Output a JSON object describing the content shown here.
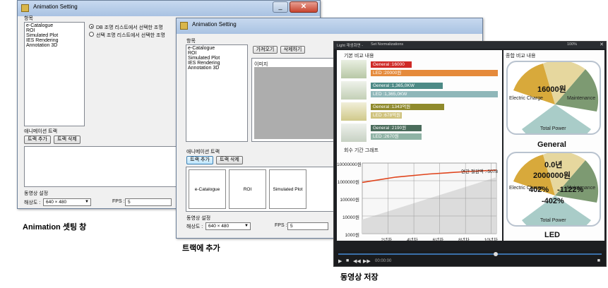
{
  "window1": {
    "title": "Animation Setting",
    "items_label": "항목",
    "items": [
      "e-Catalogue",
      "ROI",
      "Simulated Plot",
      "IES Rendering",
      "Annotation 3D"
    ],
    "radio1": "DB 조명 리스트에서 선택한 조명",
    "radio2": "선택 조명 리스트에서 선택한 조명",
    "track_label": "애니메이션 트랙",
    "add_track": "트랙 추가",
    "del_track": "트랙 삭제",
    "video_label": "동영상 설정",
    "resolution_label": "해상도 :",
    "resolution_value": "640 × 480",
    "fps_label": "FPS :",
    "fps_value": "5"
  },
  "window2": {
    "title": "Animation Setting",
    "items_label": "항목",
    "items": [
      "e-Catalogue",
      "ROI",
      "Simulated Plot",
      "IES Rendering",
      "Annotation 3D"
    ],
    "load_btn": "가져오기",
    "delete_btn": "삭제하기",
    "image_label": "이미지",
    "track_label": "애니메이션 트랙",
    "add_track": "트랙 추가",
    "del_track": "트랙 삭제",
    "track_items": [
      "e-Catalogue",
      "ROI",
      "Simulated Plot"
    ],
    "video_label": "동영상 설정",
    "resolution_label": "해상도 :",
    "resolution_value": "640 × 480",
    "fps_label": "FPS :",
    "fps_value": "5"
  },
  "player": {
    "title_left": "Light 재생화면 -",
    "title_mid": "Set  Normalizations",
    "title_right": "100%",
    "basic_label": "기본 비교 내용",
    "bars": [
      {
        "general": "General :16000",
        "led": "LED :20000원"
      },
      {
        "general": "General :1,365,0KW",
        "led": "LED :1,365,0KW"
      },
      {
        "general": "General :1343억원",
        "led": "LED :678억원"
      },
      {
        "general": "General :2190원",
        "led": "LED :2670원"
      }
    ],
    "bar_colors": {
      "general_red": "#cf2a27",
      "general_teal": "#4d8a86",
      "general_olive": "#8f8a2c",
      "general_green": "#4a6c5b",
      "led": "#e58a3b",
      "led2": "#8fb7b9"
    },
    "total_label": "종합 비교 내용",
    "gauge1": {
      "center_value": "16000원",
      "left": "Electric Charge",
      "right": "Maintenance",
      "bottom": "Total Power",
      "name": "General"
    },
    "gauge2": {
      "top_value": "0.0년",
      "center_value": "2000000원",
      "left_pct": "402%",
      "right_pct": "-1122%",
      "bottom_pct": "-402%",
      "left": "Electric Charge",
      "right": "Maintenance",
      "bottom": "Total Power",
      "name": "LED"
    },
    "period_label": "회수 기간 그래프",
    "annotation": "연간 절감액 :-5078",
    "time_display": "00:00:00",
    "chart_data": {
      "type": "line",
      "yticks": [
        "10000000원",
        "1000000원",
        "100000원",
        "10000원",
        "1000원"
      ],
      "xticks": [
        "2년차",
        "4년차",
        "6년차",
        "8년차",
        "10년차"
      ],
      "series": [
        {
          "values": [
            800000,
            1600000,
            2400000,
            3200000,
            4000000
          ]
        }
      ],
      "log_scale": true
    }
  },
  "captions": {
    "c1": "Animation 셋팅 창",
    "c2": "트랙에 추가",
    "c3": "동영상 저장"
  }
}
